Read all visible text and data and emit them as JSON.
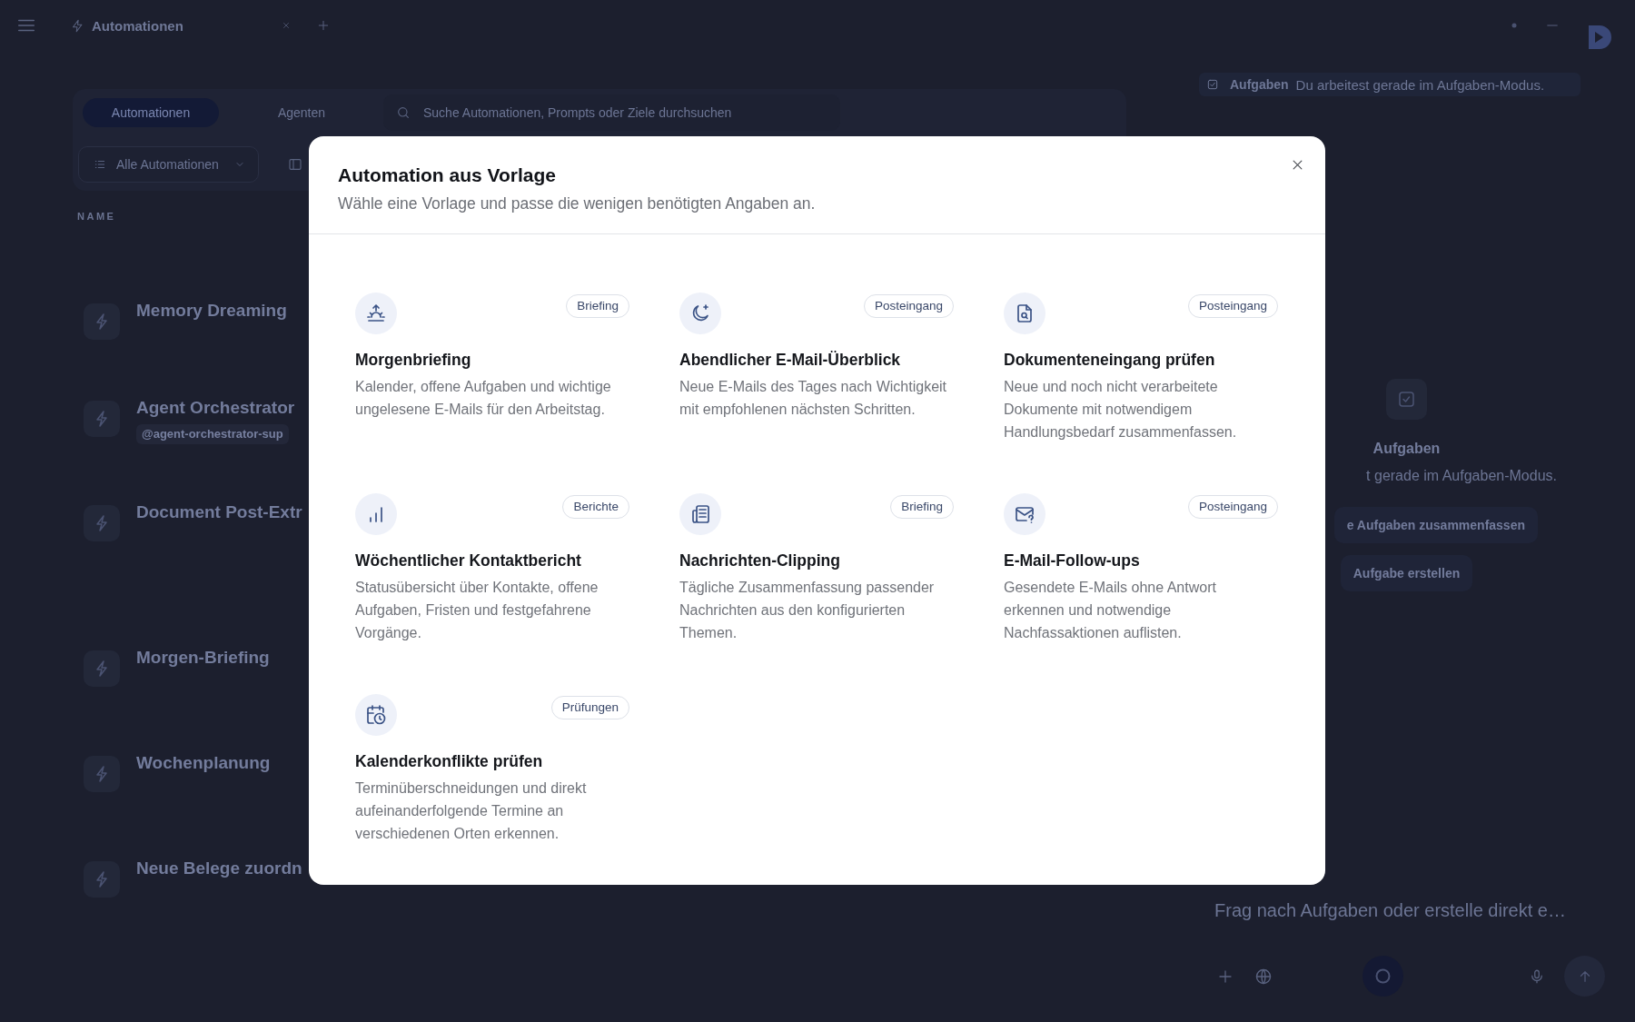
{
  "app_bar": {
    "tab_title": "Automationen"
  },
  "automations_view": {
    "view_tabs": [
      {
        "label": "Automationen",
        "selected": true
      },
      {
        "label": "Agenten",
        "selected": false
      }
    ],
    "search": {
      "placeholder": "Suche Automationen, Prompts oder Ziele durchsuchen"
    },
    "filter": {
      "label": "Alle Automationen"
    },
    "column_header": "NAME",
    "sections": [
      {
        "rows": [
          {
            "title": "Memory Dreaming"
          },
          {
            "title": "Agent Orchestrator",
            "tag": "@agent-orchestrator-sup"
          },
          {
            "title": "Document Post-Extr"
          }
        ]
      },
      {
        "rows": [
          {
            "title": "Morgen-Briefing"
          },
          {
            "title": "Wochenplanung"
          },
          {
            "title": "Neue Belege zuordn"
          }
        ]
      }
    ]
  },
  "tasks_panel": {
    "banner": {
      "title": "Aufgaben",
      "text": "Du arbeitest gerade im Aufgaben-Modus."
    },
    "empty_state": {
      "heading": "Aufgaben",
      "text": "t gerade im Aufgaben-Modus.",
      "buttons": [
        "e Aufgaben zusammenfassen",
        "Aufgabe erstellen"
      ]
    },
    "composer": {
      "placeholder": "Frag nach Aufgaben oder erstelle direkt e…"
    }
  },
  "dialog": {
    "title": "Automation aus Vorlage",
    "subtitle": "Wähle eine Vorlage und passe die wenigen benötigten Angaben an.",
    "templates": [
      {
        "title": "Morgenbriefing",
        "category": "Briefing",
        "description": "Kalender, offene Aufgaben und wichtige ungelesene E-Mails für den Arbeitstag."
      },
      {
        "title": "Abendlicher E-Mail-Überblick",
        "category": "Posteingang",
        "description": "Neue E-Mails des Tages nach Wichtigkeit mit empfohlenen nächsten Schritten."
      },
      {
        "title": "Dokumenteneingang prüfen",
        "category": "Posteingang",
        "description": "Neue und noch nicht verarbeitete Dokumente mit notwendigem Handlungsbedarf zusammenfassen."
      },
      {
        "title": "Wöchentlicher Kontaktbericht",
        "category": "Berichte",
        "description": "Statusübersicht über Kontakte, offene Aufgaben, Fristen und festgefahrene Vorgänge."
      },
      {
        "title": "Nachrichten-Clipping",
        "category": "Briefing",
        "description": "Tägliche Zusammenfassung passender Nachrichten aus den konfigurierten Themen."
      },
      {
        "title": "E-Mail-Follow-ups",
        "category": "Posteingang",
        "description": "Gesendete E-Mails ohne Antwort erkennen und notwendige Nachfassaktionen auflisten."
      },
      {
        "title": "Kalenderkonflikte prüfen",
        "category": "Prüfungen",
        "description": "Terminüberschneidungen und direkt aufeinanderfolgende Termine an verschiedenen Orten erkennen."
      }
    ]
  }
}
